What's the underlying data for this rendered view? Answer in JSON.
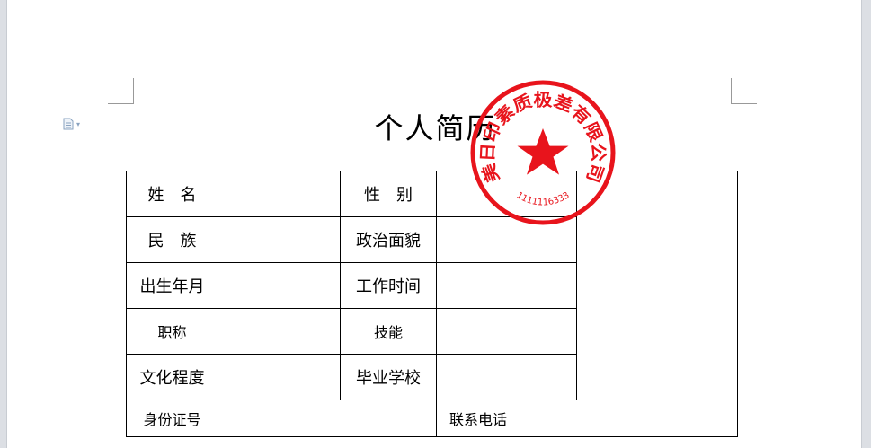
{
  "document": {
    "title": "个人简历",
    "rows": [
      [
        "姓　名",
        "",
        "性　别",
        ""
      ],
      [
        "民　族",
        "",
        "政治面貌",
        ""
      ],
      [
        "出生年月",
        "",
        "工作时间",
        ""
      ],
      [
        "职称",
        "",
        "技能",
        ""
      ],
      [
        "文化程度",
        "",
        "毕业学校",
        ""
      ]
    ],
    "id_row": {
      "id_label": "身份证号",
      "id_value": "",
      "phone_label": "联系电话",
      "phone_value": ""
    },
    "photo": ""
  },
  "seal": {
    "text": "美日印素质极差有限公司",
    "number": "1111116333",
    "color": "#e8141c",
    "icon": "star-icon"
  },
  "icons": {
    "doc_icon": "document-icon",
    "caret": "chevron-down-icon"
  },
  "colors": {
    "background": "#dcdfe4",
    "page": "#ffffff",
    "seal": "#e8141c"
  }
}
